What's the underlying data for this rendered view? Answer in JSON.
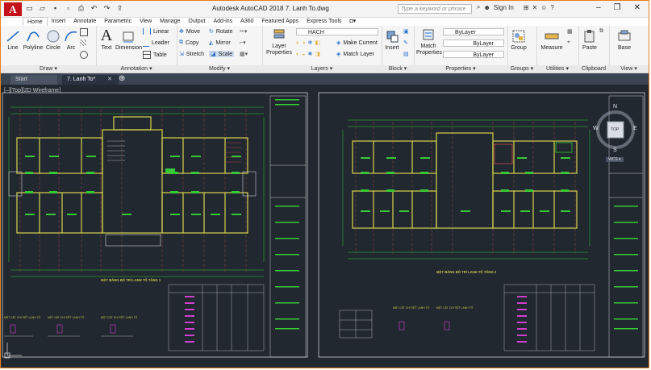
{
  "app": {
    "title": "Autodesk AutoCAD 2018   7. Lanh To.dwg",
    "logo_letter": "A",
    "search_placeholder": "Type a keyword or phrase",
    "sign_in": "Sign In",
    "window_controls": [
      "–",
      "❐",
      "✕"
    ]
  },
  "ribbon_tabs": [
    "Home",
    "Insert",
    "Annotate",
    "Parametric",
    "View",
    "Manage",
    "Output",
    "Add-ins",
    "A360",
    "Featured Apps",
    "Express Tools"
  ],
  "active_tab": "Home",
  "draw": {
    "title": "Draw ▾",
    "tools": [
      "Line",
      "Polyline",
      "Circle",
      "Arc"
    ]
  },
  "text_tools": {
    "text": "Text",
    "dimension": "Dimension"
  },
  "annotation": {
    "title": "Annotation ▾",
    "linear": "Linear",
    "leader": "Leader",
    "table": "Table"
  },
  "modify": {
    "title": "Modify ▾",
    "move": "Move",
    "rotate": "Rotate",
    "copy": "Copy",
    "mirror": "Mirror",
    "stretch": "Stretch",
    "scale": "Scale"
  },
  "layers": {
    "title": "Layers ▾",
    "layer_properties": "Layer Properties",
    "current_layer": "HACH",
    "make_current": "Make Current",
    "match_layer": "Match Layer"
  },
  "block": {
    "title": "Block ▾",
    "insert": "Insert"
  },
  "properties": {
    "title": "Properties ▾",
    "match": "Match Properties",
    "color": "ByLayer",
    "linetype": "ByLayer",
    "lineweight": "ByLayer"
  },
  "groups": {
    "title": "Groups ▾",
    "group": "Group"
  },
  "utilities": {
    "title": "Utilities ▾",
    "measure": "Measure"
  },
  "clipboard": {
    "title": "Clipboard",
    "paste": "Paste"
  },
  "view": {
    "title": "View ▾",
    "base": "Base"
  },
  "doc_tabs": [
    "Start",
    "7. Lanh To*"
  ],
  "viewport_label": "[–][Top][2D Wireframe]",
  "navcube": {
    "top": "TOP",
    "n": "N",
    "s": "S",
    "e": "E",
    "w": "W",
    "wcs": "WCS ▾"
  },
  "drawing": {
    "left_title": "MẶT BẰNG BỐ TRÍ LANH TÔ TẦNG 1",
    "right_title": "MẶT BẰNG BỐ TRÍ LANH TÔ TẦNG 2",
    "detail_labels": [
      "MẶT CẮT CHI TIẾT LANH TÔ",
      "MẶT CẮT CHI TIẾT LANH TÔ",
      "MẶT CẮT CHI TIẾT LANH TÔ"
    ]
  },
  "colors": {
    "accent": "#e87f1c",
    "canvas": "#212830",
    "wall": "#c8c84a",
    "dim": "#37c837",
    "text_magenta": "#d040d0"
  }
}
